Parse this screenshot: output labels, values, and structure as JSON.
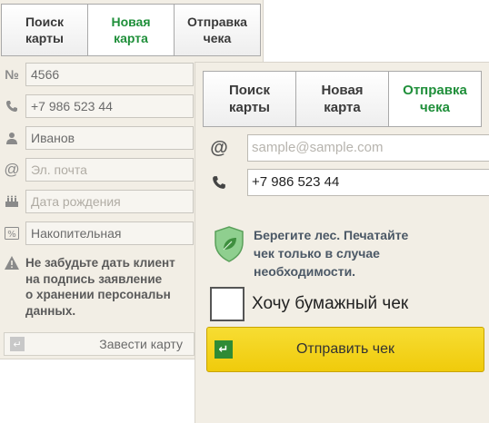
{
  "back_form": {
    "tabs": [
      {
        "label": "Поиск\nкарты",
        "active": false
      },
      {
        "label": "Новая\nкарта",
        "active": true
      },
      {
        "label": "Отправка\nчека",
        "active": false
      }
    ],
    "fields": {
      "number": {
        "icon": "number-sign-icon",
        "glyph": "№",
        "value": "4566"
      },
      "phone": {
        "icon": "phone-icon",
        "value": "+7 986 523 44"
      },
      "surname": {
        "icon": "person-icon",
        "value": "Иванов"
      },
      "email": {
        "icon": "at-sign-icon",
        "glyph": "@",
        "placeholder": "Эл. почта"
      },
      "birthday": {
        "icon": "cake-icon",
        "placeholder": "Дата рождения"
      },
      "card_type": {
        "icon": "percent-icon",
        "value": "Накопительная"
      }
    },
    "warning": "Не забудьте дать клиент\nна подпись заявление\nо хранении персональн\nданных.",
    "create_button": "Завести карту"
  },
  "front_form": {
    "tabs": [
      {
        "label": "Поиск\nкарты",
        "active": false
      },
      {
        "label": "Новая\nкарта",
        "active": false
      },
      {
        "label": "Отправка\nчека",
        "active": true
      }
    ],
    "email": {
      "glyph": "@",
      "placeholder": "sample@sample.com"
    },
    "phone": {
      "value": "+7 986 523 44"
    },
    "eco_message": "Берегите лес. Печатайте\nчек только в случае\nнеобходимости.",
    "paper_receipt_label": "Хочу бумажный чек",
    "send_button": "Отправить чек"
  },
  "colors": {
    "active_tab_text": "#1f8f3a",
    "panel_bg": "#f2eee5",
    "send_button": "#f0cb0b",
    "ok_icon": "#2f8b35"
  }
}
